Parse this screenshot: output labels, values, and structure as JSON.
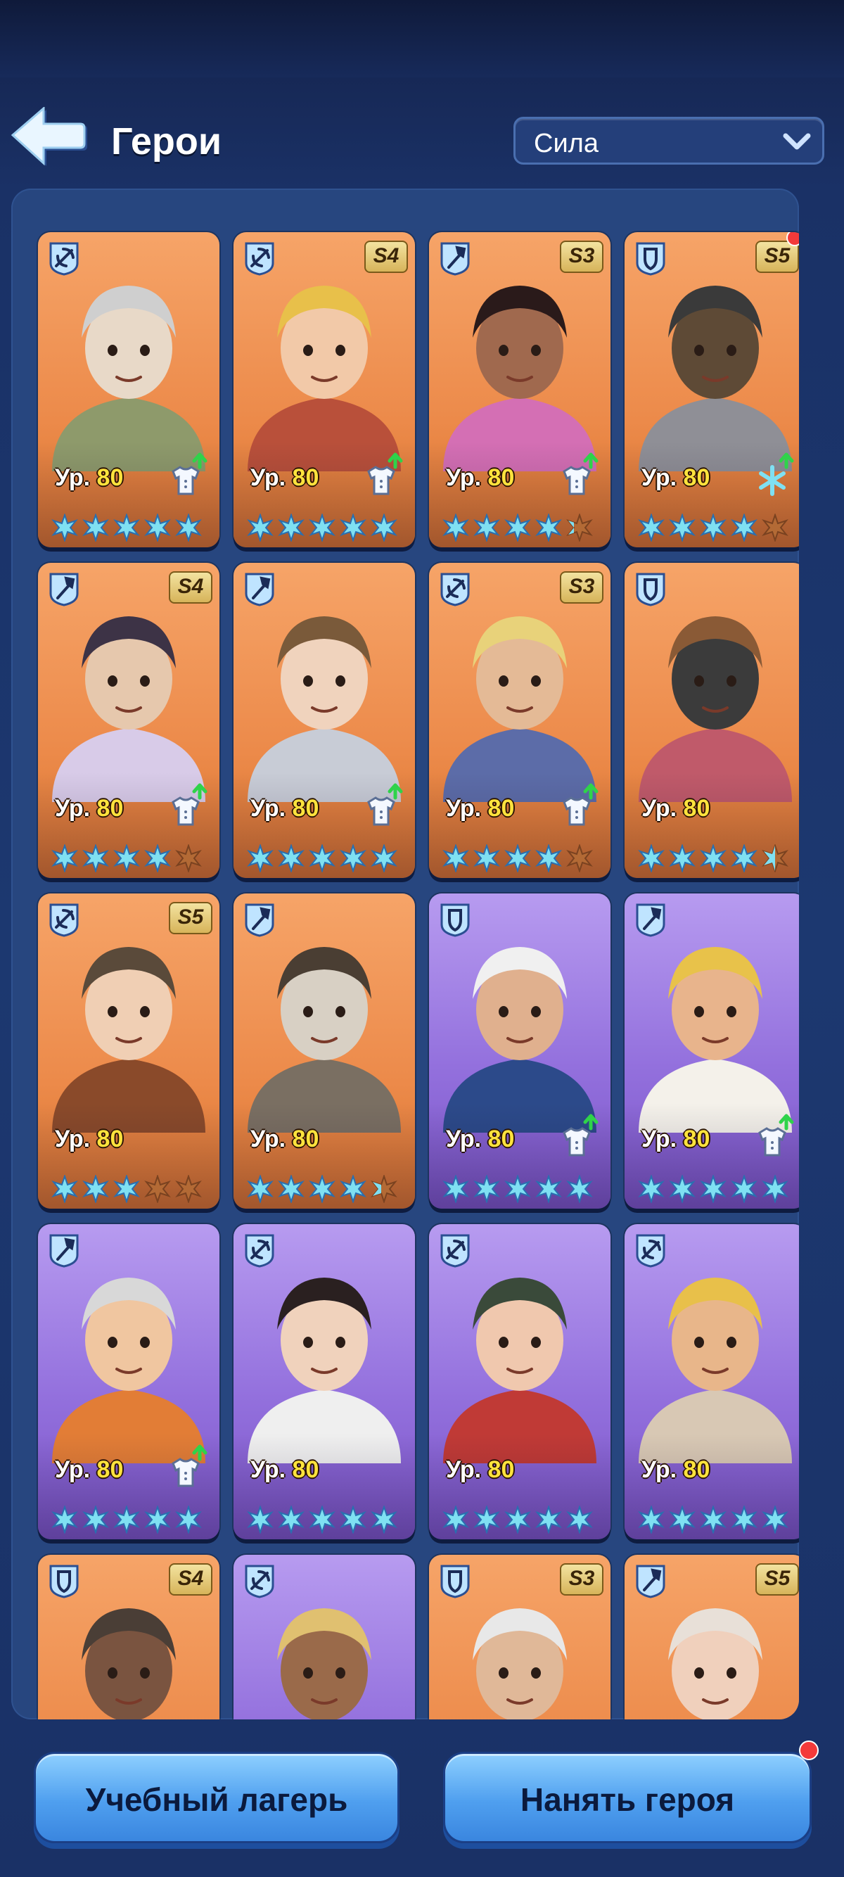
{
  "header": {
    "title": "Герои",
    "sort": {
      "selected": "Сила"
    }
  },
  "colors": {
    "orange": "#ec8a4a",
    "purple": "#9370dd",
    "star_full": "#7fe0f2",
    "star_empty": "#b36a35",
    "accent_yellow": "#ffe33d"
  },
  "level_prefix": "Ур.",
  "heroes": [
    {
      "role": "marksman-icon",
      "rarity": "orange",
      "season": "",
      "level": "80",
      "upgrade": true,
      "gear": "shirt",
      "stars": 5,
      "partial": 0,
      "dot": false,
      "portrait": "old-bearded-man"
    },
    {
      "role": "marksman-icon",
      "rarity": "orange",
      "season": "S4",
      "level": "80",
      "upgrade": true,
      "gear": "shirt",
      "stars": 5,
      "partial": 0,
      "dot": false,
      "portrait": "red-cap-youth"
    },
    {
      "role": "lancer-icon",
      "rarity": "orange",
      "season": "S3",
      "level": "80",
      "upgrade": true,
      "gear": "shirt",
      "stars": 4,
      "partial": 0.3,
      "dot": false,
      "portrait": "pink-earmuff-girl"
    },
    {
      "role": "infantry-icon",
      "rarity": "orange",
      "season": "S5",
      "level": "80",
      "upgrade": true,
      "gear": "snowflake",
      "stars": 4,
      "partial": 0,
      "dot": true,
      "portrait": "knight-helmet"
    },
    {
      "role": "lancer-icon",
      "rarity": "orange",
      "season": "S4",
      "level": "80",
      "upgrade": true,
      "gear": "shirt",
      "stars": 4,
      "partial": 0,
      "dot": false,
      "portrait": "headband-girl"
    },
    {
      "role": "lancer-icon",
      "rarity": "orange",
      "season": "",
      "level": "80",
      "upgrade": true,
      "gear": "shirt",
      "stars": 5,
      "partial": 0,
      "dot": false,
      "portrait": "goggles-girl"
    },
    {
      "role": "marksman-icon",
      "rarity": "orange",
      "season": "S3",
      "level": "80",
      "upgrade": true,
      "gear": "shirt",
      "stars": 4,
      "partial": 0,
      "dot": false,
      "portrait": "monocle-man"
    },
    {
      "role": "infantry-icon",
      "rarity": "orange",
      "season": "",
      "level": "80",
      "upgrade": false,
      "gear": "",
      "stars": 4,
      "partial": 0.5,
      "dot": false,
      "portrait": "iron-mask"
    },
    {
      "role": "marksman-icon",
      "rarity": "orange",
      "season": "S5",
      "level": "80",
      "upgrade": false,
      "gear": "",
      "stars": 3,
      "partial": 0,
      "dot": false,
      "portrait": "pilot-girl"
    },
    {
      "role": "lancer-icon",
      "rarity": "orange",
      "season": "",
      "level": "80",
      "upgrade": false,
      "gear": "",
      "stars": 4,
      "partial": 0.4,
      "dot": false,
      "portrait": "plague-mask"
    },
    {
      "role": "infantry-icon",
      "rarity": "purple",
      "season": "",
      "level": "80",
      "upgrade": true,
      "gear": "shirt",
      "stars": 5,
      "partial": 0,
      "dot": false,
      "portrait": "police-cap"
    },
    {
      "role": "lancer-icon",
      "rarity": "purple",
      "season": "",
      "level": "80",
      "upgrade": true,
      "gear": "shirt",
      "stars": 5,
      "partial": 0,
      "dot": false,
      "portrait": "chef-man"
    },
    {
      "role": "lancer-icon",
      "rarity": "purple",
      "season": "",
      "level": "80",
      "upgrade": true,
      "gear": "shirt",
      "stars": 5,
      "partial": 0,
      "dot": false,
      "portrait": "viking-goggles"
    },
    {
      "role": "marksman-icon",
      "rarity": "purple",
      "season": "",
      "level": "80",
      "upgrade": false,
      "gear": "",
      "stars": 5,
      "partial": 0,
      "dot": false,
      "portrait": "dark-hair-girl"
    },
    {
      "role": "marksman-icon",
      "rarity": "purple",
      "season": "",
      "level": "80",
      "upgrade": false,
      "gear": "",
      "stars": 5,
      "partial": 0,
      "dot": false,
      "portrait": "red-hair-girl"
    },
    {
      "role": "marksman-icon",
      "rarity": "purple",
      "season": "",
      "level": "80",
      "upgrade": false,
      "gear": "",
      "stars": 5,
      "partial": 0,
      "dot": false,
      "portrait": "blonde-goggles-man"
    },
    {
      "role": "infantry-icon",
      "rarity": "orange",
      "season": "S4",
      "level": "",
      "upgrade": false,
      "gear": "",
      "stars": 0,
      "partial": 0,
      "dot": false,
      "portrait": "hooded-man"
    },
    {
      "role": "marksman-icon",
      "rarity": "purple",
      "season": "",
      "level": "",
      "upgrade": false,
      "gear": "",
      "stars": 0,
      "partial": 0,
      "dot": false,
      "portrait": "turban-man"
    },
    {
      "role": "infantry-icon",
      "rarity": "orange",
      "season": "S3",
      "level": "",
      "upgrade": false,
      "gear": "",
      "stars": 0,
      "partial": 0,
      "dot": false,
      "portrait": "white-hair-old"
    },
    {
      "role": "lancer-icon",
      "rarity": "orange",
      "season": "S5",
      "level": "",
      "upgrade": false,
      "gear": "",
      "stars": 0,
      "partial": 0,
      "dot": false,
      "portrait": "aviator-cap-girl"
    }
  ],
  "buttons": {
    "camp": "Учебный лагерь",
    "hire": "Нанять героя"
  }
}
